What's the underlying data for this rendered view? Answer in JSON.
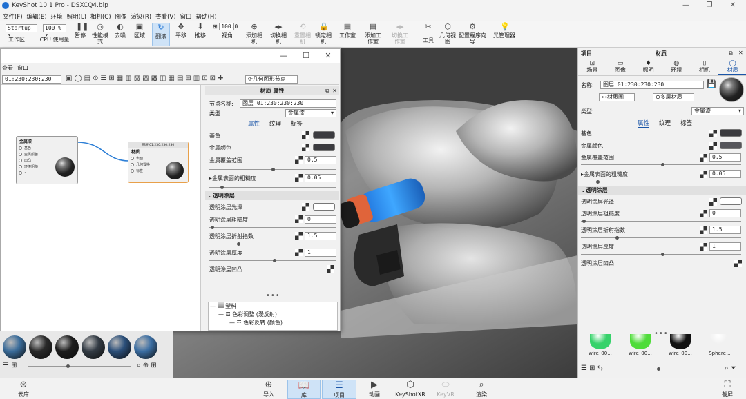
{
  "window": {
    "title": "KeyShot 10.1 Pro - DSXCQ4.bip"
  },
  "menu": [
    "文件(F)",
    "编辑(E)",
    "环境",
    "照明(L)",
    "相机(C)",
    "图像",
    "渲染(R)",
    "查看(V)",
    "窗口",
    "帮助(H)"
  ],
  "toolbar": {
    "workspace_select": "Startup",
    "zoom_select": "100 %",
    "fov_value": "100.0",
    "items": [
      {
        "label": "工作区",
        "icon": "workspace-icon"
      },
      {
        "label": "CPU 使用量",
        "icon": "cpu-icon"
      },
      {
        "label": "暂停",
        "icon": "pause-icon"
      },
      {
        "label": "性能模式",
        "icon": "performance-icon"
      },
      {
        "label": "去噪",
        "icon": "denoise-icon"
      },
      {
        "label": "区域",
        "icon": "region-icon"
      },
      {
        "label": "翻滚",
        "icon": "tumble-icon"
      },
      {
        "label": "平移",
        "icon": "pan-icon"
      },
      {
        "label": "推移",
        "icon": "dolly-icon"
      },
      {
        "label": "视角",
        "icon": "view-angle-icon"
      },
      {
        "label": "添加相机",
        "icon": "add-camera-icon"
      },
      {
        "label": "切换相机",
        "icon": "switch-camera-icon"
      },
      {
        "label": "重置相机",
        "icon": "reset-camera-icon"
      },
      {
        "label": "锁定相机",
        "icon": "lock-camera-icon"
      },
      {
        "label": "工作室",
        "icon": "studio-icon"
      },
      {
        "label": "添加工作室",
        "icon": "add-studio-icon"
      },
      {
        "label": "切换工作室",
        "icon": "switch-studio-icon"
      },
      {
        "label": "工具",
        "icon": "tools-icon"
      },
      {
        "label": "几何视图",
        "icon": "geometry-view-icon"
      },
      {
        "label": "配置程序向导",
        "icon": "configurator-icon"
      },
      {
        "label": "光管理器",
        "icon": "light-manager-icon"
      }
    ]
  },
  "material_window": {
    "menu": [
      "查看",
      "窗口"
    ],
    "material_name_field": "01:230:230:230",
    "toolbar_button_label": "几何图形节点",
    "panel_title": "材质 属性",
    "node_name_label": "节点名称:",
    "node_name_value": "图层 01:230:230:230",
    "type_label": "类型:",
    "type_value": "金属漆",
    "tabs": [
      "属性",
      "纹理",
      "标签"
    ],
    "props": [
      {
        "label": "基色",
        "kind": "color",
        "color": "#3b3b3f"
      },
      {
        "label": "金属颜色",
        "kind": "color",
        "color": "#3b3b3f"
      },
      {
        "label": "金属覆盖范围",
        "kind": "number",
        "value": "0.5"
      },
      {
        "label": "金属表面的粗糙度",
        "kind": "number",
        "value": "0.05"
      }
    ],
    "clearcoat_section": "透明涂层",
    "clearcoat_props": [
      {
        "label": "透明涂层光泽",
        "kind": "color",
        "color": "#ffffff"
      },
      {
        "label": "透明涂层粗糙度",
        "kind": "number",
        "value": "0"
      },
      {
        "label": "透明涂层折射指数",
        "kind": "number",
        "value": "1.5"
      },
      {
        "label": "透明涂层厚度",
        "kind": "number",
        "value": "1"
      },
      {
        "label": "透明涂层凹凸",
        "kind": "texture"
      }
    ],
    "tree": [
      {
        "label": "塑料",
        "level": 0
      },
      {
        "label": "色彩调整 (漫反射)",
        "level": 1
      },
      {
        "label": "色彩反转 (颜色)",
        "level": 2
      }
    ],
    "node_left": {
      "title": "金属漆",
      "ports": [
        "基色",
        "金属颜色",
        "凹凸",
        "环境粗糙",
        "•"
      ]
    },
    "node_right": {
      "header": "图层 01:230:230:230",
      "title": "材质",
      "ports": [
        "表面",
        "几何置换",
        "标签"
      ]
    }
  },
  "right_panel": {
    "header_left": "项目",
    "header_center": "材质",
    "tabs": [
      {
        "label": "场景",
        "icon": "scene-icon"
      },
      {
        "label": "图像",
        "icon": "image-icon"
      },
      {
        "label": "照明",
        "icon": "lighting-icon"
      },
      {
        "label": "环境",
        "icon": "environment-icon"
      },
      {
        "label": "相机",
        "icon": "camera-icon"
      },
      {
        "label": "材质",
        "icon": "material-icon"
      }
    ],
    "name_label": "名称:",
    "name_value": "图层 01:230:230:230",
    "material_graph_button": "材质图",
    "multilayer_button": "多层材质",
    "type_label": "类型:",
    "type_value": "金属漆",
    "subtabs": [
      "属性",
      "纹理",
      "标签"
    ],
    "props": [
      {
        "label": "基色",
        "kind": "color",
        "color": "#3b3b3f"
      },
      {
        "label": "金属颜色",
        "kind": "color",
        "color": "#55555a"
      },
      {
        "label": "金属覆盖范围",
        "kind": "number",
        "value": "0.5"
      },
      {
        "label": "金属表面的粗糙度",
        "kind": "number",
        "value": "0.05"
      }
    ],
    "clearcoat_section": "透明涂层",
    "clearcoat_props": [
      {
        "label": "透明涂层光泽",
        "kind": "color",
        "color": "#ffffff"
      },
      {
        "label": "透明涂层粗糙度",
        "kind": "number",
        "value": "0"
      },
      {
        "label": "透明涂层折射指数",
        "kind": "number",
        "value": "1.5"
      },
      {
        "label": "透明涂层厚度",
        "kind": "number",
        "value": "1"
      },
      {
        "label": "透明涂层凹凸",
        "kind": "texture"
      }
    ],
    "swatches": [
      {
        "label": "wire_00...",
        "color": "#36d26a"
      },
      {
        "label": "wire_00...",
        "color": "#4fdc3a"
      },
      {
        "label": "wire_00...",
        "color": "#111111"
      },
      {
        "label": "Sphere ...",
        "color": "#f1f1f1"
      }
    ]
  },
  "library_swatches": [
    "#3a6c9a",
    "#2a2a2a",
    "#1d1d1d",
    "#333b44",
    "#2b4f7a",
    "#3b6ea3"
  ],
  "bottom_bar": {
    "cloud_library": "云库",
    "items": [
      {
        "label": "导入",
        "icon": "import-icon"
      },
      {
        "label": "库",
        "icon": "library-icon"
      },
      {
        "label": "项目",
        "icon": "project-icon"
      },
      {
        "label": "动画",
        "icon": "animation-icon"
      },
      {
        "label": "KeyShotXR",
        "icon": "keyshotxr-icon"
      },
      {
        "label": "KeyVR",
        "icon": "keyvr-icon"
      },
      {
        "label": "渲染",
        "icon": "render-icon"
      }
    ],
    "screenshot": "截屏"
  },
  "colors": {
    "accent": "#1a55a8",
    "active_bg": "#cfe3f7",
    "node_link": "#2d7fd6",
    "node_selected": "#e8a04a"
  }
}
